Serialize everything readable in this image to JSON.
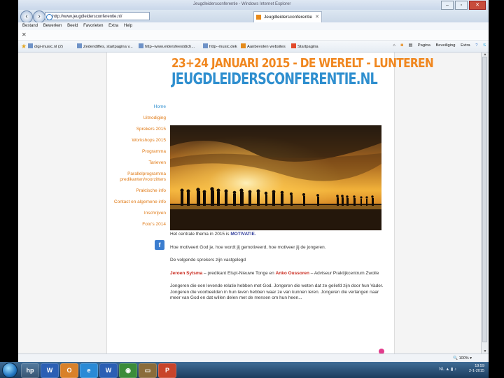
{
  "window": {
    "title": "Jeugdleidersconferentie - Windows Internet Explorer"
  },
  "nav": {
    "address": "http://www.jeugdleidersconferentie.nl/",
    "tab_label": "Jeugdleidersconferentie"
  },
  "menu": [
    "Bestand",
    "Bewerken",
    "Beeld",
    "Favorieten",
    "Extra",
    "Help"
  ],
  "favorites": [
    {
      "label": "digi-music.nl (2)"
    },
    {
      "label": "Zedendifles, startpagina v..."
    },
    {
      "label": "http--www.eldersfeestdich..."
    },
    {
      "label": "http--music.dek"
    },
    {
      "label": "Aanbevolen websites"
    },
    {
      "label": "Startpagina"
    }
  ],
  "toolbar": {
    "page": "Pagina",
    "safety": "Beveiliging",
    "tools": "Extra"
  },
  "site": {
    "banner_line1": "23+24 JANUARI 2015 - DE WERELT - LUNTEREN",
    "banner_line2": "JEUGDLEIDERSCONFERENTIE.NL",
    "nav": [
      {
        "label": "Home",
        "active": true
      },
      {
        "label": "Uitnodiging"
      },
      {
        "label": "Sprekers 2015"
      },
      {
        "label": "Workshops 2015"
      },
      {
        "label": "Programma"
      },
      {
        "label": "Tarieven"
      },
      {
        "label": "Parallelprogramma predikanten/voorzitters"
      },
      {
        "label": "Praktische info"
      },
      {
        "label": "Contact en algemene info"
      },
      {
        "label": "Inschrijven"
      },
      {
        "label": "Foto's 2014"
      }
    ],
    "theme_prefix": "Het centrale thema in 2015 is ",
    "theme_word": "MOTIVATIE.",
    "question": "Hoe motiveert God je, hoe wordt jij gemotiveerd, hoe motiveer jij de jongeren.",
    "speakers_intro": "De volgende sprekers zijn vastgelegd",
    "speaker1_name": "Jeroen Sytsma",
    "speaker1_role": " – predikant Elspt-Nieuwe Tonge en ",
    "speaker2_name": "Anko Oussoren",
    "speaker2_role": " – Adviseur Praktijkcentrum Zwolle",
    "paragraph": "Jongeren die een levende relatie hebben met God. Jongeren die weten dat ze geliefd zijn door hun Vader. Jongeren die voorbeelden in hun leven hebben waar ze van kunnen leren. Jongeren die verlangen naar meer van God en dat willen delen met de mensen om hun heen..."
  },
  "status": {
    "zoom": "100%"
  },
  "taskbar": {
    "time": "19:59",
    "date": "2-1-2015",
    "lang": "NL"
  },
  "colors": {
    "orange": "#f0871f",
    "blue": "#2f8fcf",
    "red": "#c9281c"
  }
}
